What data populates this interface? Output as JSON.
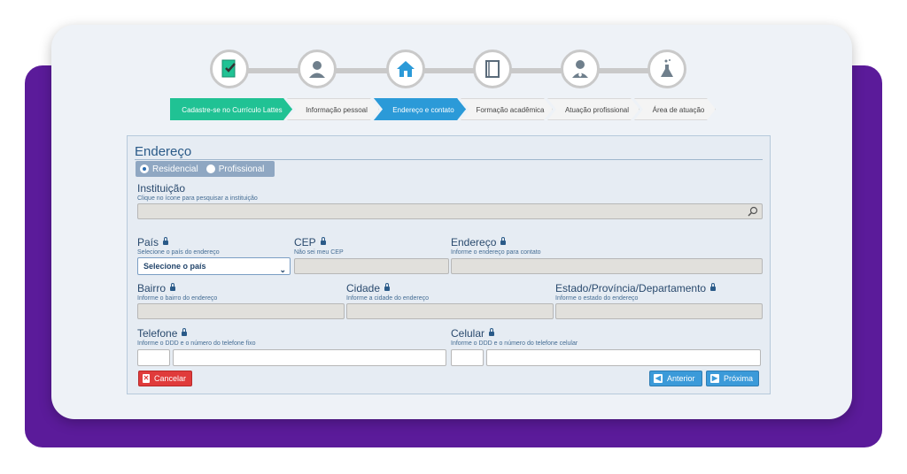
{
  "steps": [
    {
      "icon": "resume-check-icon",
      "color": "#20c294"
    },
    {
      "icon": "person-icon",
      "color": "#5a6b7a"
    },
    {
      "icon": "home-icon",
      "color": "#2b9ad8"
    },
    {
      "icon": "book-icon",
      "color": "#5a6b7a"
    },
    {
      "icon": "person-tie-icon",
      "color": "#5a6b7a"
    },
    {
      "icon": "flask-icon",
      "color": "#5a6b7a"
    }
  ],
  "crumbs": [
    {
      "label": "Cadastre-se no Currículo Lattes"
    },
    {
      "label": "Informação pessoal"
    },
    {
      "label": "Endereço e contato"
    },
    {
      "label": "Formação acadêmica"
    },
    {
      "label": "Atuação profissional"
    },
    {
      "label": "Área de atuação"
    }
  ],
  "form": {
    "title": "Endereço",
    "radio_residencial": "Residencial",
    "radio_profissional": "Profissional",
    "instituicao": {
      "label": "Instituição",
      "hint": "Clique no ícone para pesquisar a instituição"
    },
    "pais": {
      "label": "País",
      "hint": "Selecione o país do endereço",
      "selected": "Selecione o país"
    },
    "cep": {
      "label": "CEP",
      "hint": "Não sei meu CEP"
    },
    "endereco": {
      "label": "Endereço",
      "hint": "Informe o endereço para contato"
    },
    "bairro": {
      "label": "Bairro",
      "hint": "Informe o bairro do endereço"
    },
    "cidade": {
      "label": "Cidade",
      "hint": "Informe a cidade do endereço"
    },
    "estado": {
      "label": "Estado/Província/Departamento",
      "hint": "Informe o estado do endereço"
    },
    "telefone": {
      "label": "Telefone",
      "hint": "Informe o DDD e o número do telefone fixo"
    },
    "celular": {
      "label": "Celular",
      "hint": "Informe o DDD e o número do telefone celular"
    },
    "cancel_label": "Cancelar",
    "prev_label": "Anterior",
    "next_label": "Próxima"
  },
  "colors": {
    "accent_green": "#20c294",
    "accent_blue": "#2b9ad8",
    "cancel_red": "#e03b3b",
    "frame_purple": "#5b1b9a"
  }
}
